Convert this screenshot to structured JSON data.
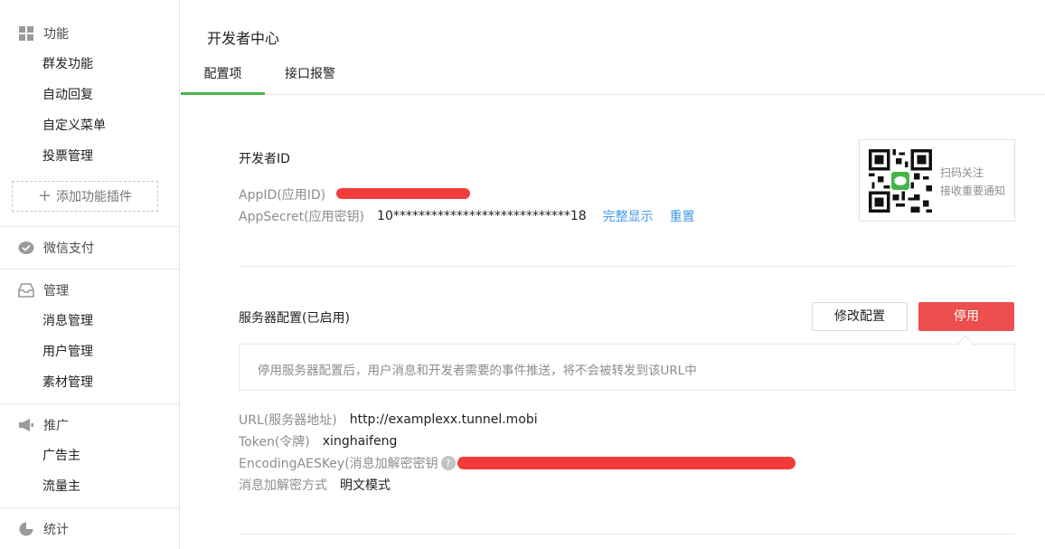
{
  "sidebar": {
    "groups": [
      {
        "label": "功能",
        "icon": "grid-icon",
        "items": [
          "群发功能",
          "自动回复",
          "自定义菜单",
          "投票管理"
        ]
      },
      {
        "label": "微信支付",
        "icon": "wechat-pay-icon"
      },
      {
        "label": "管理",
        "icon": "inbox-icon",
        "items": [
          "消息管理",
          "用户管理",
          "素材管理"
        ]
      },
      {
        "label": "推广",
        "icon": "megaphone-icon",
        "items": [
          "广告主",
          "流量主"
        ]
      },
      {
        "label": "统计",
        "icon": "pie-chart-icon"
      }
    ],
    "add_plugin": "添加功能插件"
  },
  "header": {
    "title": "开发者中心",
    "tabs": [
      {
        "label": "配置项",
        "active": true
      },
      {
        "label": "接口报警",
        "active": false
      }
    ]
  },
  "developer": {
    "section_title": "开发者ID",
    "appid_label": "AppID(应用ID)",
    "appsecret_label": "AppSecret(应用密钥)",
    "appsecret_value": "10****************************18",
    "show_full": "完整显示",
    "reset": "重置",
    "qr_line1": "扫码关注",
    "qr_line2": "接收重要通知"
  },
  "server": {
    "section_title": "服务器配置(已启用)",
    "modify_button": "修改配置",
    "disable_button": "停用",
    "tip": "停用服务器配置后，用户消息和开发者需要的事件推送，将不会被转发到该URL中",
    "url_label": "URL(服务器地址)",
    "url_value": "http://examplexx.tunnel.mobi",
    "token_label": "Token(令牌)",
    "token_value": "xinghaifeng",
    "aeskey_label": "EncodingAESKey(消息加解密密钥",
    "aeskey_suffix": ")",
    "help_glyph": "?",
    "encrypt_label": "消息加解密方式",
    "encrypt_value": "明文模式"
  },
  "colors": {
    "accent_green": "#44b549",
    "danger_red": "#ed4e4e",
    "link_blue": "#459ae9",
    "redaction_red": "#f23c3c"
  }
}
